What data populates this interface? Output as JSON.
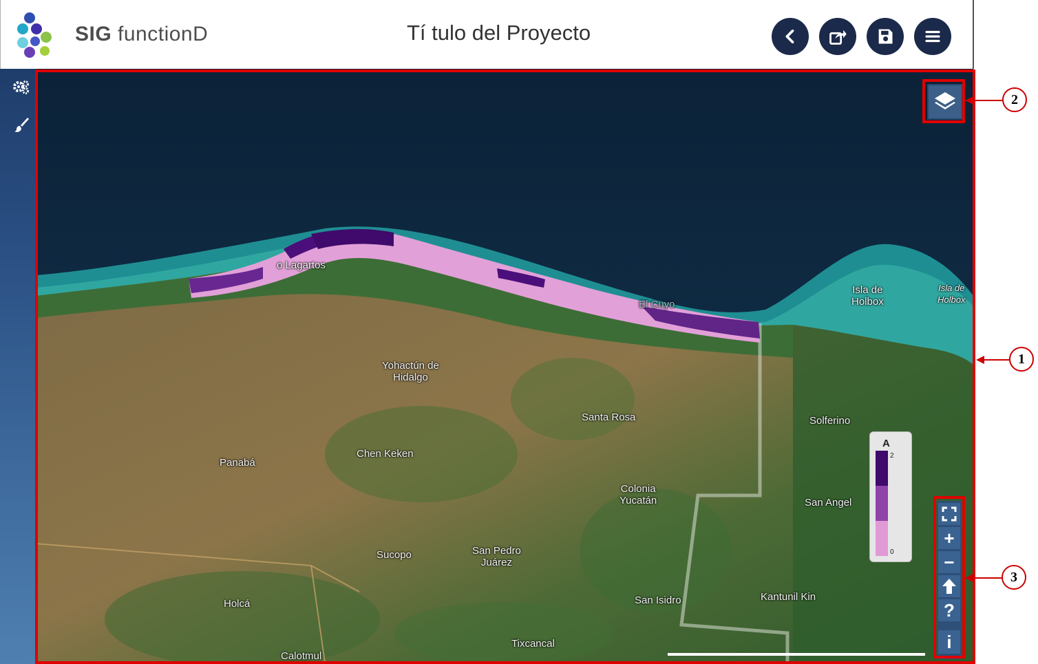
{
  "header": {
    "brand_bold": "SIG",
    "brand_rest": "functionD",
    "project_title": "Tí tulo del Proyecto",
    "buttons": [
      {
        "name": "back-button",
        "icon": "chevron-left-icon"
      },
      {
        "name": "share-button",
        "icon": "share-icon"
      },
      {
        "name": "save-button",
        "icon": "save-icon"
      },
      {
        "name": "menu-button",
        "icon": "hamburger-menu-icon"
      }
    ]
  },
  "sidebar": {
    "items": [
      {
        "name": "sidebar-item-settings",
        "icon": "gears-icon"
      },
      {
        "name": "sidebar-item-style",
        "icon": "brush-icon"
      }
    ]
  },
  "map": {
    "places": [
      {
        "key": "rio_lagartos",
        "label": "o Lagartos"
      },
      {
        "key": "el_cuyo",
        "label": "El Cuyo"
      },
      {
        "key": "isla_holbox",
        "label": "Isla de\nHolbox"
      },
      {
        "key": "isla_holbox_2",
        "label": "Isla de\nHolbox"
      },
      {
        "key": "yohactun",
        "label": "Yohactún de\nHidalgo"
      },
      {
        "key": "santa_rosa",
        "label": "Santa Rosa"
      },
      {
        "key": "solferino",
        "label": "Solferino"
      },
      {
        "key": "panaba",
        "label": "Panabá"
      },
      {
        "key": "chen_keken",
        "label": "Chen Keken"
      },
      {
        "key": "colonia_yucatan",
        "label": "Colonia\nYucatán"
      },
      {
        "key": "san_angel",
        "label": "San Angel"
      },
      {
        "key": "sucopo",
        "label": "Sucopo"
      },
      {
        "key": "san_pedro",
        "label": "San Pedro\nJuárez"
      },
      {
        "key": "holca",
        "label": "Holcá"
      },
      {
        "key": "san_isidro",
        "label": "San Isidro"
      },
      {
        "key": "kantunil",
        "label": "Kantunil Kin"
      },
      {
        "key": "tixcancal",
        "label": "Tixcancal"
      },
      {
        "key": "calotmul",
        "label": "Calotmul"
      }
    ],
    "layers_icon": "layers-icon",
    "legend": {
      "title": "A",
      "max_label": "2",
      "min_label": "0",
      "colors": [
        "#3f0a6b",
        "#8e44a8",
        "#e09ad6"
      ]
    },
    "controls": [
      {
        "name": "fullscreen-button",
        "icon": "fullscreen-icon",
        "glyph": ""
      },
      {
        "name": "zoom-in-button",
        "icon": "plus-icon",
        "glyph": "+"
      },
      {
        "name": "zoom-out-button",
        "icon": "minus-icon",
        "glyph": "−"
      },
      {
        "name": "north-button",
        "icon": "arrow-up-icon",
        "glyph": ""
      },
      {
        "name": "help-button",
        "icon": "question-icon",
        "glyph": "?"
      },
      {
        "name": "info-button",
        "icon": "info-icon",
        "glyph": "i"
      }
    ]
  },
  "annotations": {
    "callouts": [
      "1",
      "2",
      "3"
    ],
    "highlight_color": "#e00000"
  }
}
